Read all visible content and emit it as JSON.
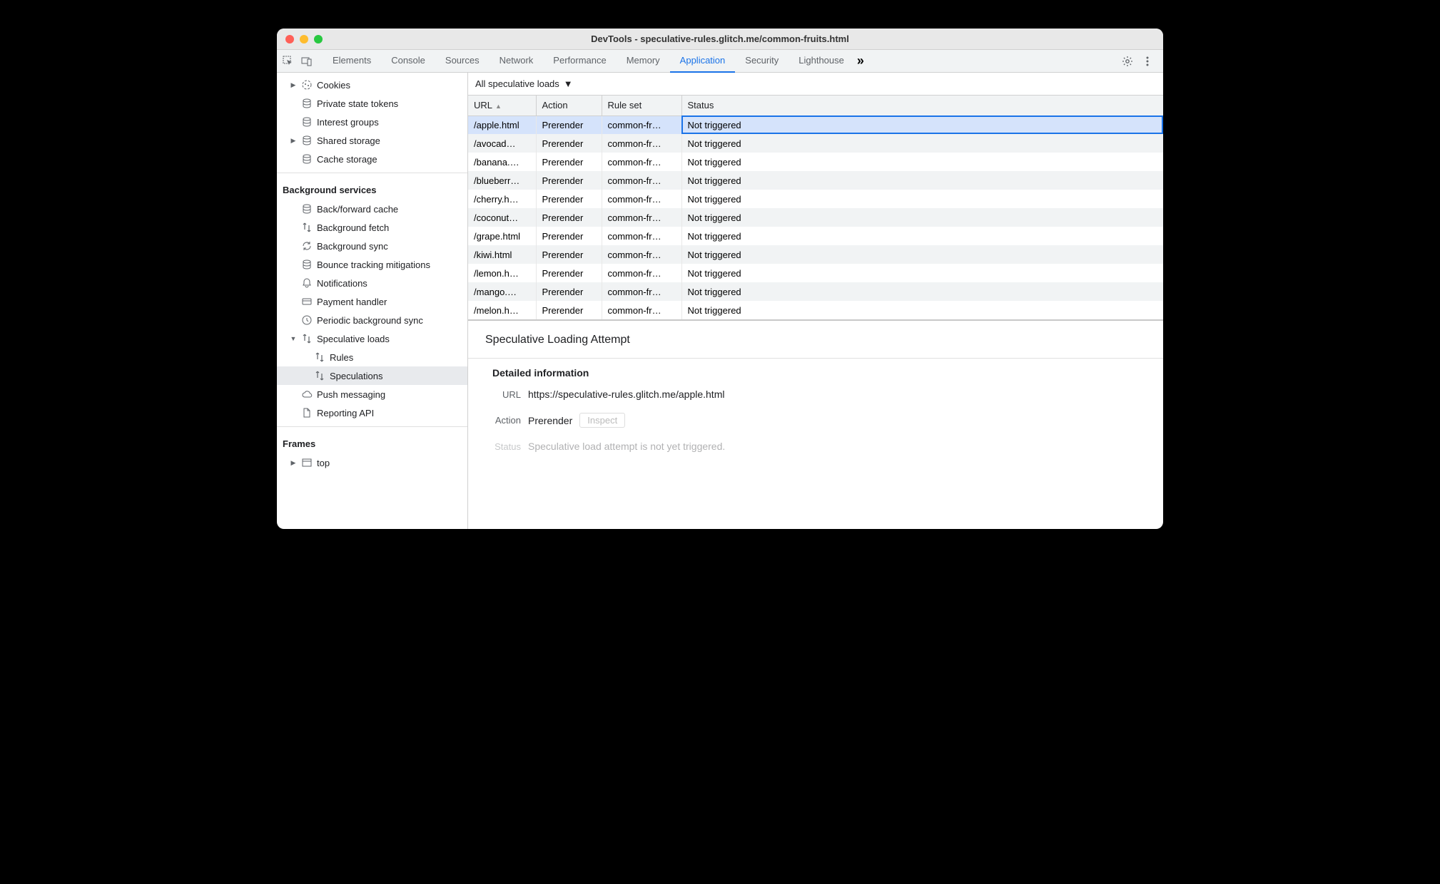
{
  "window": {
    "title": "DevTools - speculative-rules.glitch.me/common-fruits.html"
  },
  "toolbar": {
    "tabs": [
      "Elements",
      "Console",
      "Sources",
      "Network",
      "Performance",
      "Memory",
      "Application",
      "Security",
      "Lighthouse"
    ],
    "active_tab": "Application",
    "more_label": "»"
  },
  "sidebar": {
    "storage_items": [
      {
        "label": "Cookies",
        "icon": "cookie",
        "arrow": "▶",
        "indent": 0
      },
      {
        "label": "Private state tokens",
        "icon": "db",
        "indent": 0
      },
      {
        "label": "Interest groups",
        "icon": "db",
        "indent": 0
      },
      {
        "label": "Shared storage",
        "icon": "db",
        "arrow": "▶",
        "indent": 0
      },
      {
        "label": "Cache storage",
        "icon": "db",
        "indent": 0
      }
    ],
    "bg_title": "Background services",
    "bg_items": [
      {
        "label": "Back/forward cache",
        "icon": "db"
      },
      {
        "label": "Background fetch",
        "icon": "updown"
      },
      {
        "label": "Background sync",
        "icon": "sync"
      },
      {
        "label": "Bounce tracking mitigations",
        "icon": "db"
      },
      {
        "label": "Notifications",
        "icon": "bell"
      },
      {
        "label": "Payment handler",
        "icon": "card"
      },
      {
        "label": "Periodic background sync",
        "icon": "clock"
      },
      {
        "label": "Speculative loads",
        "icon": "updown",
        "arrow": "▼",
        "expanded": true
      },
      {
        "label": "Rules",
        "icon": "updown",
        "indent": 1
      },
      {
        "label": "Speculations",
        "icon": "updown",
        "indent": 1,
        "selected": true
      },
      {
        "label": "Push messaging",
        "icon": "cloud"
      },
      {
        "label": "Reporting API",
        "icon": "doc"
      }
    ],
    "frames_title": "Frames",
    "frames_items": [
      {
        "label": "top",
        "icon": "frame",
        "arrow": "▶"
      }
    ]
  },
  "filter": {
    "label": "All speculative loads"
  },
  "table": {
    "columns": [
      "URL",
      "Action",
      "Rule set",
      "Status"
    ],
    "sort_col": 0,
    "rows": [
      {
        "url": "/apple.html",
        "action": "Prerender",
        "ruleset": "common-fr…",
        "status": "Not triggered",
        "selected": true
      },
      {
        "url": "/avocad…",
        "action": "Prerender",
        "ruleset": "common-fr…",
        "status": "Not triggered"
      },
      {
        "url": "/banana.…",
        "action": "Prerender",
        "ruleset": "common-fr…",
        "status": "Not triggered"
      },
      {
        "url": "/blueberr…",
        "action": "Prerender",
        "ruleset": "common-fr…",
        "status": "Not triggered"
      },
      {
        "url": "/cherry.h…",
        "action": "Prerender",
        "ruleset": "common-fr…",
        "status": "Not triggered"
      },
      {
        "url": "/coconut…",
        "action": "Prerender",
        "ruleset": "common-fr…",
        "status": "Not triggered"
      },
      {
        "url": "/grape.html",
        "action": "Prerender",
        "ruleset": "common-fr…",
        "status": "Not triggered"
      },
      {
        "url": "/kiwi.html",
        "action": "Prerender",
        "ruleset": "common-fr…",
        "status": "Not triggered"
      },
      {
        "url": "/lemon.h…",
        "action": "Prerender",
        "ruleset": "common-fr…",
        "status": "Not triggered"
      },
      {
        "url": "/mango.…",
        "action": "Prerender",
        "ruleset": "common-fr…",
        "status": "Not triggered"
      },
      {
        "url": "/melon.h…",
        "action": "Prerender",
        "ruleset": "common-fr…",
        "status": "Not triggered"
      }
    ]
  },
  "detail": {
    "heading": "Speculative Loading Attempt",
    "section": "Detailed information",
    "url_label": "URL",
    "url_value": "https://speculative-rules.glitch.me/apple.html",
    "action_label": "Action",
    "action_value": "Prerender",
    "inspect_label": "Inspect",
    "status_label": "Status",
    "status_value": "Speculative load attempt is not yet triggered."
  }
}
